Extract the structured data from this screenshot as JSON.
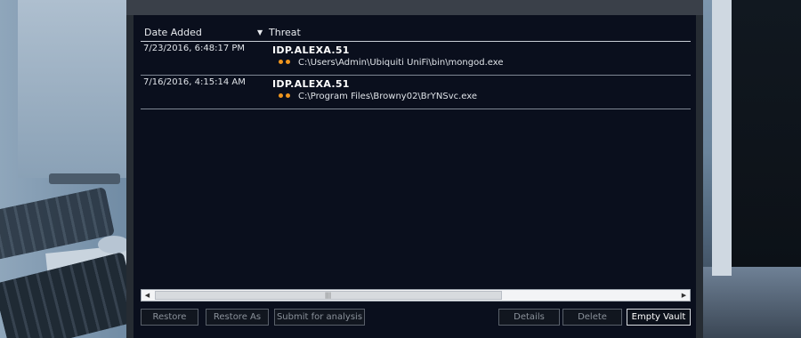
{
  "table": {
    "headers": {
      "date_added": "Date Added",
      "threat": "Threat",
      "sort_icon": "sort-descending-icon"
    },
    "rows": [
      {
        "date_added": "7/23/2016, 6:48:17 PM",
        "threat": "IDP.ALEXA.51",
        "path": "C:\\Users\\Admin\\Ubiquiti UniFi\\bin\\mongod.exe"
      },
      {
        "date_added": "7/16/2016, 4:15:14 AM",
        "threat": "IDP.ALEXA.51",
        "path": "C:\\Program Files\\Browny02\\BrYNSvc.exe"
      }
    ]
  },
  "buttons": {
    "restore": "Restore",
    "restore_as": "Restore As",
    "submit": "Submit for analysis",
    "details": "Details",
    "delete": "Delete",
    "empty_vault": "Empty Vault"
  },
  "colors": {
    "panel_bg": "#0a0f1d",
    "severity_dot": "#f0961e"
  }
}
